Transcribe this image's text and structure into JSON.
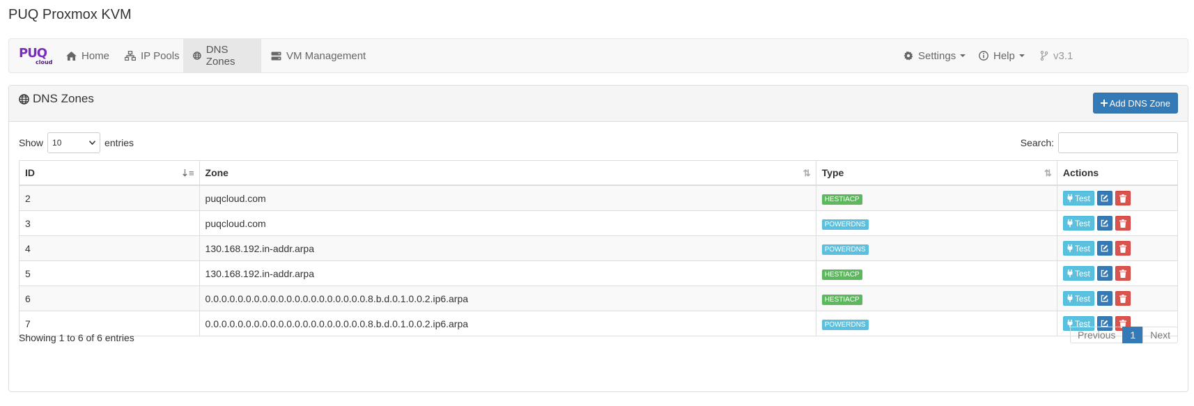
{
  "app": {
    "title": "PUQ Proxmox KVM"
  },
  "logo": {
    "main": "PUQ",
    "sub": "cloud"
  },
  "nav": {
    "items": [
      {
        "label": "Home",
        "icon": "home-icon"
      },
      {
        "label": "IP Pools",
        "icon": "sitemap-icon"
      },
      {
        "label": "DNS Zones",
        "icon": "globe-icon",
        "active": true
      },
      {
        "label": "VM Management",
        "icon": "server-icon"
      }
    ],
    "right": [
      {
        "label": "Settings",
        "icon": "gear-icon"
      },
      {
        "label": "Help",
        "icon": "info-icon"
      },
      {
        "label": "v3.1",
        "icon": "branch-icon"
      }
    ]
  },
  "panel": {
    "title": "DNS Zones",
    "add_button": "Add DNS Zone"
  },
  "controls": {
    "show_label": "Show",
    "length_value": "10",
    "entries_label": "entries",
    "search_label": "Search:",
    "search_value": ""
  },
  "table": {
    "headers": [
      "ID",
      "Zone",
      "Type",
      "Actions"
    ],
    "rows": [
      {
        "id": "2",
        "zone": "puqcloud.com",
        "type": "HESTIACP"
      },
      {
        "id": "3",
        "zone": "puqcloud.com",
        "type": "POWERDNS"
      },
      {
        "id": "4",
        "zone": "130.168.192.in-addr.arpa",
        "type": "POWERDNS"
      },
      {
        "id": "5",
        "zone": "130.168.192.in-addr.arpa",
        "type": "HESTIACP"
      },
      {
        "id": "6",
        "zone": "0.0.0.0.0.0.0.0.0.0.0.0.0.0.0.0.0.0.0.0.8.b.d.0.1.0.0.2.ip6.arpa",
        "type": "HESTIACP"
      },
      {
        "id": "7",
        "zone": "0.0.0.0.0.0.0.0.0.0.0.0.0.0.0.0.0.0.0.0.8.b.d.0.1.0.0.2.ip6.arpa",
        "type": "POWERDNS"
      }
    ],
    "test_label": "Test"
  },
  "footer": {
    "info": "Showing 1 to 6 of 6 entries",
    "prev": "Previous",
    "page": "1",
    "next": "Next"
  },
  "colors": {
    "HESTIACP": "#5cb85c",
    "POWERDNS": "#5bc0de",
    "primary": "#337ab7",
    "danger": "#d9534f"
  }
}
